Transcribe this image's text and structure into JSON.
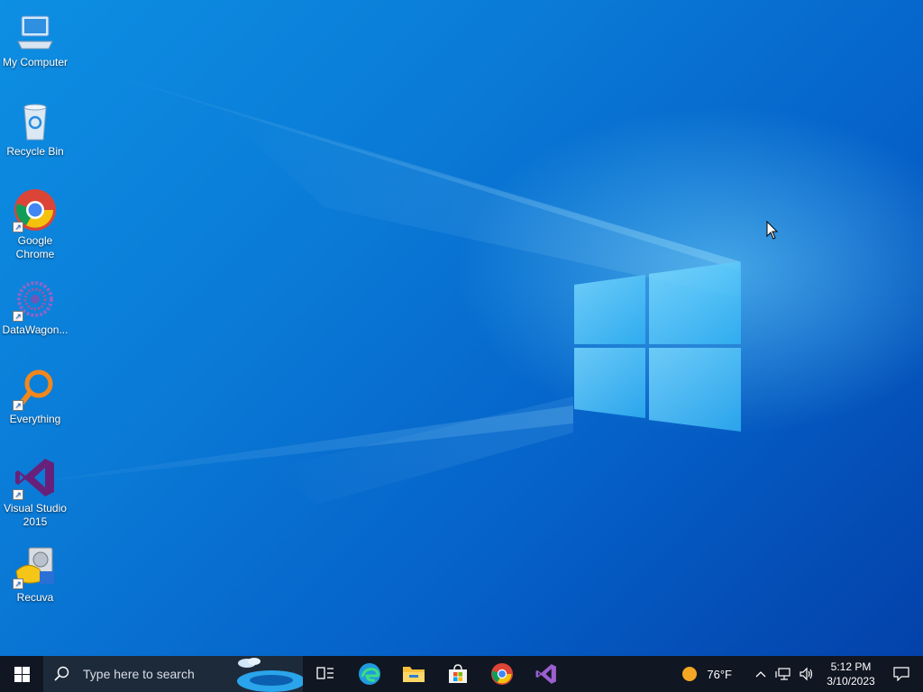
{
  "desktop": {
    "icons": [
      {
        "label": "My Computer"
      },
      {
        "label": "Recycle Bin"
      },
      {
        "label": "Google Chrome"
      },
      {
        "label": "DataWagon..."
      },
      {
        "label": "Everything"
      },
      {
        "label": "Visual Studio 2015"
      },
      {
        "label": "Recuva"
      }
    ]
  },
  "taskbar": {
    "search_placeholder": "Type here to search",
    "pinned": [
      "task-view",
      "microsoft-edge",
      "file-explorer",
      "microsoft-store",
      "google-chrome",
      "visual-studio"
    ],
    "weather_temp": "76°F",
    "time": "5:12 PM",
    "date": "3/10/2023"
  },
  "colors": {
    "taskbar_bg": "#101722",
    "search_bg": "#1d2a3a",
    "wallpaper_accent": "#0a7ad6"
  }
}
